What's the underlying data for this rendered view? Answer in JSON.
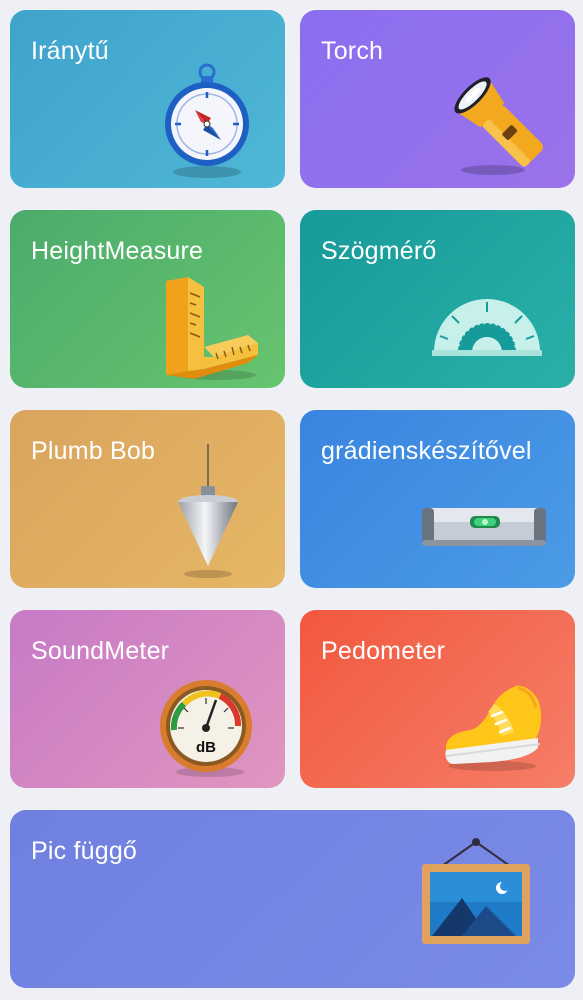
{
  "tiles": {
    "compass": {
      "label": "Iránytű",
      "icon": "compass-icon",
      "color": "#45aacf"
    },
    "torch": {
      "label": "Torch",
      "icon": "flashlight-icon",
      "color": "#8f70ee"
    },
    "height": {
      "label": "HeightMeasure",
      "icon": "ruler-icon",
      "color": "#5ab86c"
    },
    "protractor": {
      "label": "Szögmérő",
      "icon": "protractor-icon",
      "color": "#20a5a1"
    },
    "plumb": {
      "label": "Plumb Bob",
      "icon": "plumb-bob-icon",
      "color": "#dfad62"
    },
    "level": {
      "label": "grádienskészítővel",
      "icon": "spirit-level-icon",
      "color": "#4290e3"
    },
    "sound": {
      "label": "SoundMeter",
      "icon": "sound-meter-icon",
      "color": "#d488c2",
      "gauge_text": "dB"
    },
    "pedometer": {
      "label": "Pedometer",
      "icon": "shoe-icon",
      "color": "#f46b53"
    },
    "picture": {
      "label": "Pic függő",
      "icon": "picture-frame-icon",
      "color": "#7585e3"
    }
  }
}
